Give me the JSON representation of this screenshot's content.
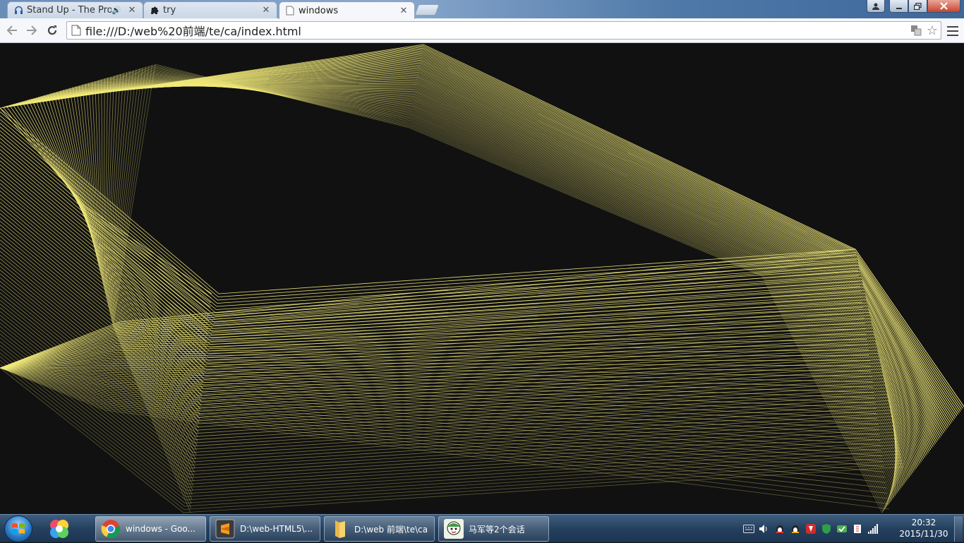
{
  "browser": {
    "tabs": [
      {
        "title": "Stand Up - The Prodi",
        "icon": "headphones-icon",
        "audio": true
      },
      {
        "title": "try",
        "icon": "puzzle-icon",
        "audio": false
      },
      {
        "title": "windows",
        "icon": "page-icon",
        "audio": false,
        "active": true
      }
    ],
    "url": "file:///D:/web%20前端/te/ca/index.html"
  },
  "canvas": {
    "background": "#111111",
    "line_color": "#f2ea7a"
  },
  "taskbar": {
    "tasks": [
      {
        "label": "windows - Goo...",
        "icon": "chrome-icon",
        "active": true
      },
      {
        "label": "D:\\web-HTML5\\...",
        "icon": "sublime-text-icon",
        "active": false
      },
      {
        "label": "D:\\web 前端\\te\\ca",
        "icon": "folder-icon",
        "active": false
      },
      {
        "label": "马军等2个会话",
        "icon": "qq-chat-icon",
        "active": false
      }
    ],
    "clock": {
      "time": "20:32",
      "date": "2015/11/30"
    }
  }
}
